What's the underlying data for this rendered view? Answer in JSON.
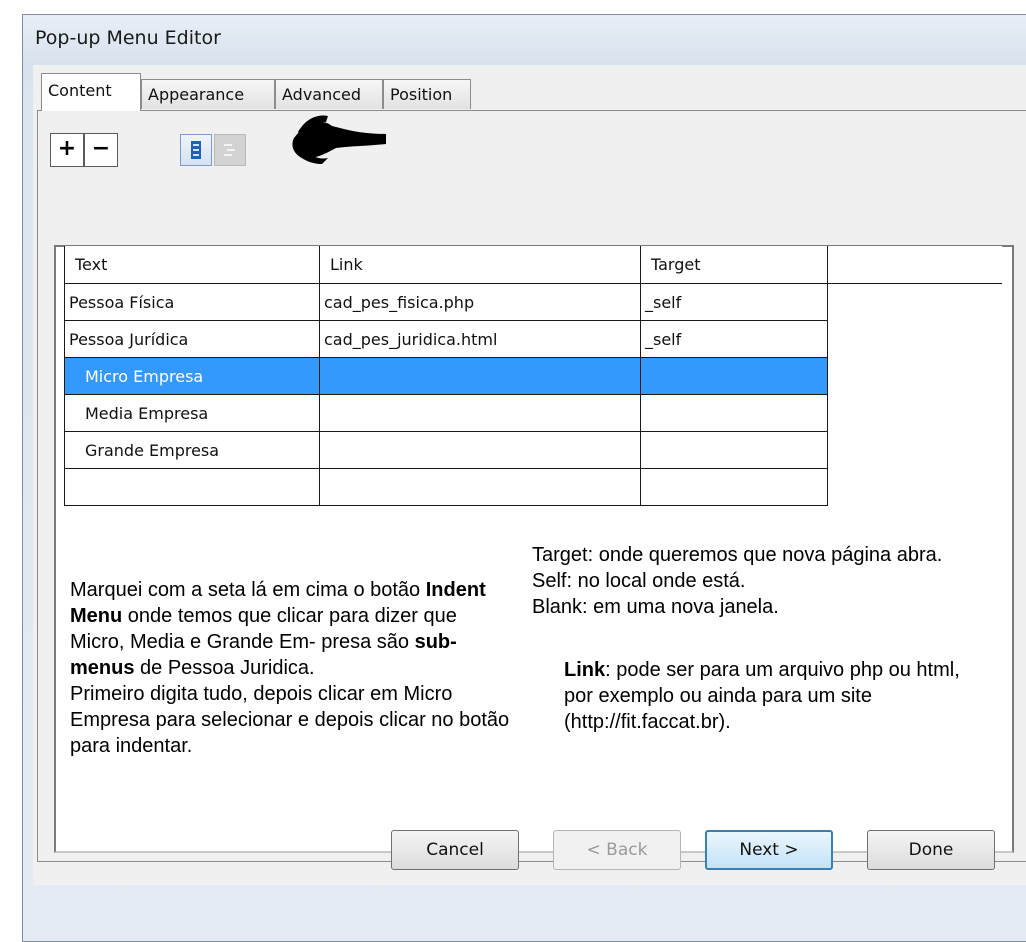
{
  "window": {
    "title": "Pop-up Menu Editor"
  },
  "tabs": [
    {
      "label": "Content",
      "active": true
    },
    {
      "label": "Appearance",
      "active": false
    },
    {
      "label": "Advanced",
      "active": false
    },
    {
      "label": "Position",
      "active": false
    }
  ],
  "toolbar": {
    "add_label": "+",
    "remove_label": "−",
    "indent_icon": "indent-menu-icon",
    "outdent_icon": "outdent-menu-icon"
  },
  "grid": {
    "headers": [
      "Text",
      "Link",
      "Target"
    ],
    "rows": [
      {
        "text": "Pessoa Física",
        "link": "cad_pes_fisica.php",
        "target": "_self"
      },
      {
        "text": "Pessoa Jurídica",
        "link": "cad_pes_juridica.html",
        "target": "_self"
      },
      {
        "text": "Micro Empresa",
        "link": "",
        "target": ""
      },
      {
        "text": "Media Empresa",
        "link": "",
        "target": ""
      },
      {
        "text": "Grande Empresa",
        "link": "",
        "target": ""
      },
      {
        "text": "",
        "link": "",
        "target": ""
      }
    ]
  },
  "notes": {
    "left_p1_a": "Marquei com a seta lá em cima o botão",
    "left_p1_bold1": "Indent Menu",
    "left_p1_b": " onde temos que clicar para dizer que Micro, Media e Grande Em- presa são ",
    "left_p1_bold2": "sub-menus",
    "left_p1_c": " de Pessoa Juridica.",
    "left_p2": "Primeiro digita tudo, depois clicar em Micro Empresa para selecionar e depois clicar no botão para indentar.",
    "target_line1": "Target: onde queremos que nova página abra.",
    "target_line2": "Self: no local onde está.",
    "target_line3": "Blank: em uma nova janela.",
    "link_bold": "Link",
    "link_rest": ": pode ser para um arquivo php ou html, por exemplo ou ainda para um site (http://fit.faccat.br)."
  },
  "footer": {
    "cancel_label": "Cancel",
    "back_label": "< Back",
    "next_label": "Next >",
    "done_label": "Done"
  },
  "colors": {
    "selection": "#3399ff",
    "annotation_arrow": "#000000"
  }
}
